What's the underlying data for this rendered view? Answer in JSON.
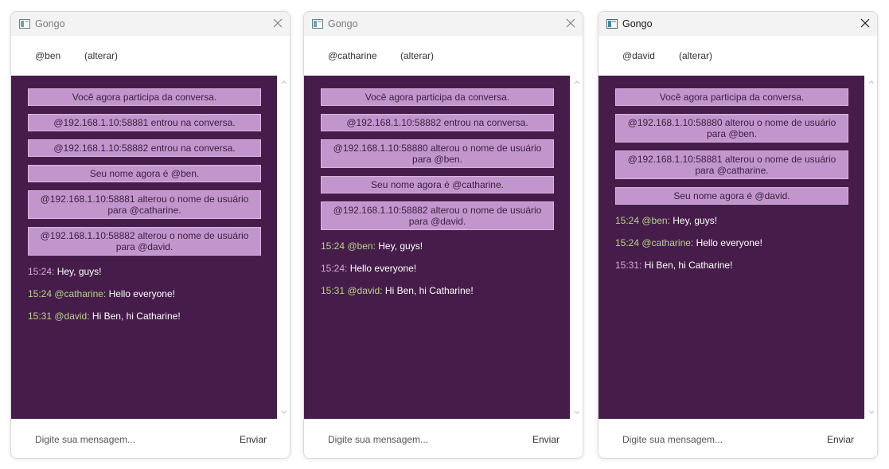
{
  "colors": {
    "chat_bg": "#461d4a",
    "system_msg_bg": "#c296cd",
    "meta_pink": "#d8a6dc",
    "meta_green": "#b8d28a"
  },
  "windows": [
    {
      "title": "Gongo",
      "username": "@ben",
      "change_label": "(alterar)",
      "system_messages": [
        [
          "Você agora participa da conversa."
        ],
        [
          "@192.168.1.10:58881 entrou na conversa."
        ],
        [
          "@192.168.1.10:58882 entrou na conversa."
        ],
        [
          "Seu nome agora é @ben."
        ],
        [
          "@192.168.1.10:58881 alterou o nome de usuário",
          "para @catharine."
        ],
        [
          "@192.168.1.10:58882 alterou o nome de usuário",
          "para @david."
        ]
      ],
      "messages": [
        {
          "meta": "15:24:",
          "text": "Hey, guys!",
          "meta_color": "pink"
        },
        {
          "meta": "15:24 @catharine:",
          "text": "Hello everyone!",
          "meta_color": "green"
        },
        {
          "meta": "15:31 @david:",
          "text": "Hi Ben, hi Catharine!",
          "meta_color": "green"
        }
      ],
      "input_placeholder": "Digite sua mensagem...",
      "send_label": "Enviar"
    },
    {
      "title": "Gongo",
      "username": "@catharine",
      "change_label": "(alterar)",
      "system_messages": [
        [
          "Você agora participa da conversa."
        ],
        [
          "@192.168.1.10:58882 entrou na conversa."
        ],
        [
          "@192.168.1.10:58880 alterou o nome de usuário",
          "para @ben."
        ],
        [
          "Seu nome agora é @catharine."
        ],
        [
          "@192.168.1.10:58882 alterou o nome de usuário",
          "para @david."
        ]
      ],
      "messages": [
        {
          "meta": "15:24 @ben:",
          "text": "Hey, guys!",
          "meta_color": "green"
        },
        {
          "meta": "15:24:",
          "text": "Hello everyone!",
          "meta_color": "pink"
        },
        {
          "meta": "15:31 @david:",
          "text": "Hi Ben, hi Catharine!",
          "meta_color": "green"
        }
      ],
      "input_placeholder": "Digite sua mensagem...",
      "send_label": "Enviar"
    },
    {
      "title": "Gongo",
      "username": "@david",
      "change_label": "(alterar)",
      "system_messages": [
        [
          "Você agora participa da conversa."
        ],
        [
          "@192.168.1.10:58880 alterou o nome de usuário",
          "para @ben."
        ],
        [
          "@192.168.1.10:58881 alterou o nome de usuário",
          "para @catharine."
        ],
        [
          "Seu nome agora é @david."
        ]
      ],
      "messages": [
        {
          "meta": "15:24 @ben:",
          "text": "Hey, guys!",
          "meta_color": "green"
        },
        {
          "meta": "15:24 @catharine:",
          "text": "Hello everyone!",
          "meta_color": "green"
        },
        {
          "meta": "15:31:",
          "text": "Hi Ben, hi Catharine!",
          "meta_color": "pink"
        }
      ],
      "input_placeholder": "Digite sua mensagem...",
      "send_label": "Enviar"
    }
  ]
}
